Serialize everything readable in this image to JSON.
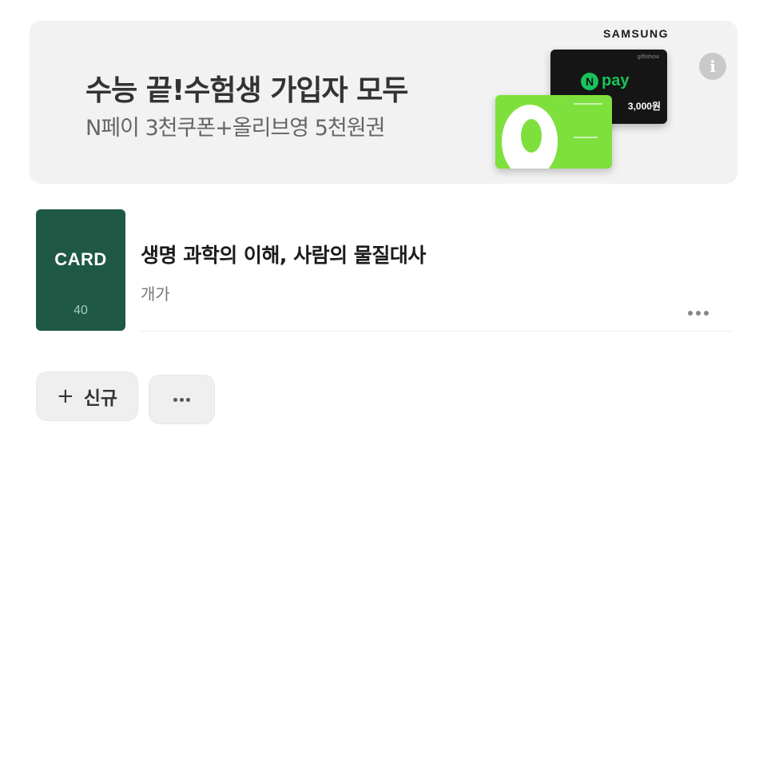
{
  "banner": {
    "title": "수능 끝!수험생 가입자 모두",
    "subtitle": "N페이 3천쿠폰+올리브영 5천원권",
    "brand": "SAMSUNG",
    "giftcard": {
      "top_label": "giftishow",
      "logo_n": "N",
      "logo_pay": "pay",
      "amount": "3,000원"
    },
    "info_icon": "i"
  },
  "item": {
    "thumb_label": "CARD",
    "thumb_count": "40",
    "title": "생명 과학의 이해, 사람의 물질대사",
    "subtitle": "개가"
  },
  "actions": {
    "new_label": "신규",
    "plus_glyph": "+"
  },
  "colors": {
    "thumb_bg": "#1f5845",
    "banner_bg": "#f2f2f2",
    "npay_green": "#19c35b",
    "olive_green": "#7ee03c"
  }
}
